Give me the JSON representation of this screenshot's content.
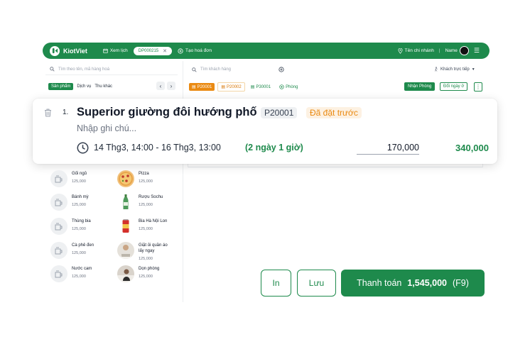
{
  "topbar": {
    "brand": "KiotViet",
    "schedule_label": "Xem lịch",
    "order_tab": "DP000215",
    "new_invoice_label": "Tạo hoá đơn",
    "branch_label": "Tên chi nhánh",
    "user_name": "Name"
  },
  "search": {
    "product_placeholder": "Tìm theo tên, mã hàng hoá",
    "customer_placeholder": "Tìm khách hàng",
    "customer_type": "Khách trực tiếp"
  },
  "category_tabs": [
    "Sản phẩm",
    "Dịch vụ",
    "Thu khác"
  ],
  "rooms": {
    "items": [
      "P20001",
      "P20002",
      "P30001"
    ],
    "add_label": "Phòng",
    "checkin_label": "Nhận Phòng",
    "change_label": "Đổi ngày ở"
  },
  "booking": {
    "index": "1.",
    "title": "Superior giường đôi hướng phố",
    "code": "P20001",
    "status": "Đã đặt trước",
    "note_placeholder": "Nhập ghi chú...",
    "dates": "14 Thg3, 14:00 - 16 Thg3, 13:00",
    "duration": "(2 ngày 1 giờ)",
    "unit_price": "170,000",
    "total": "340,000"
  },
  "products": [
    {
      "name": "Gối ngủ",
      "price": "125,000"
    },
    {
      "name": "Pizza",
      "price": "125,000"
    },
    {
      "name": "Bánh mỳ",
      "price": "125,000"
    },
    {
      "name": "Rượu Sochu",
      "price": "125,000"
    },
    {
      "name": "Thùng bia",
      "price": "125,000"
    },
    {
      "name": "Bia Hà Nội Lon",
      "price": "125,000"
    },
    {
      "name": "Cà phê đen",
      "price": "125,000"
    },
    {
      "name": "Giặt ủi quần áo lấy ngay",
      "price": "125,000"
    },
    {
      "name": "Nước cam",
      "price": "125,000"
    },
    {
      "name": "Dọn phòng",
      "price": "125,000"
    }
  ],
  "actions": {
    "print_label": "In",
    "save_label": "Lưu",
    "pay_label": "Thanh toán",
    "pay_amount": "1,545,000",
    "pay_shortcut": "(F9)"
  },
  "colors": {
    "brand_green": "#1e8a4c",
    "booked_orange": "#ea8a12"
  }
}
